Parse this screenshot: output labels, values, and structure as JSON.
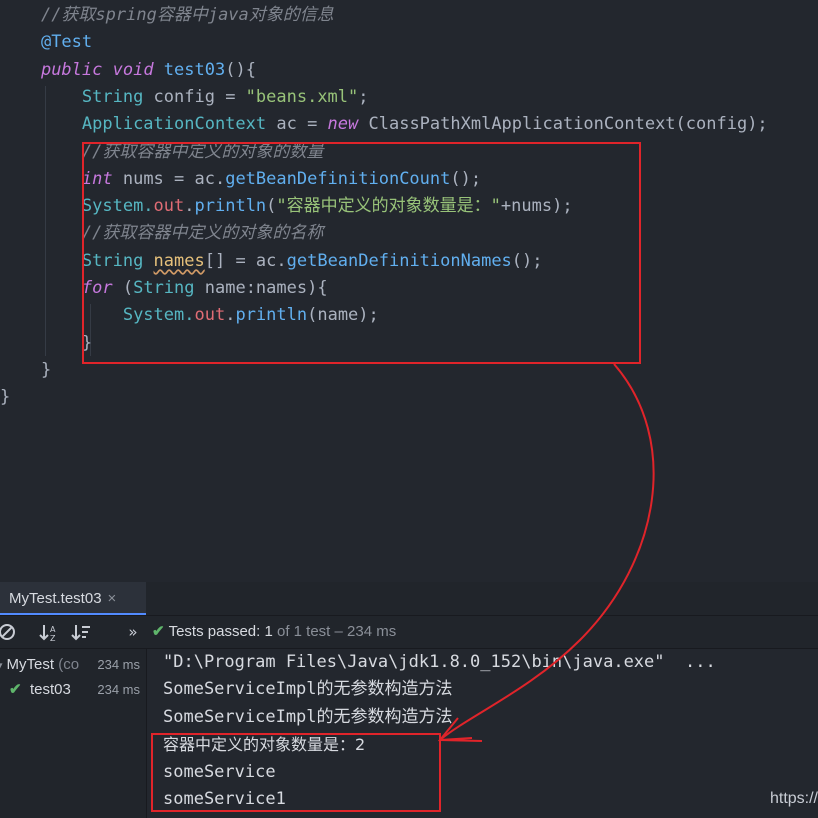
{
  "editor": {
    "lines": [
      {
        "indent": "    ",
        "parts": [
          {
            "t": "//获取spring容器中java对象的信息",
            "c": "tk-comment"
          }
        ]
      },
      {
        "indent": "    ",
        "parts": [
          {
            "t": "@Test",
            "c": "tk-anno"
          }
        ]
      },
      {
        "indent": "    ",
        "parts": [
          {
            "t": "public ",
            "c": "tk-kw"
          },
          {
            "t": "void ",
            "c": "tk-kw"
          },
          {
            "t": "test03",
            "c": "tk-fn"
          },
          {
            "t": "(){",
            "c": "tk-plain"
          }
        ]
      },
      {
        "indent": "        ",
        "parts": [
          {
            "t": "String ",
            "c": "tk-type"
          },
          {
            "t": "config = ",
            "c": "tk-plain"
          },
          {
            "t": "\"beans.xml\"",
            "c": "tk-str"
          },
          {
            "t": ";",
            "c": "tk-plain"
          }
        ]
      },
      {
        "indent": "        ",
        "parts": [
          {
            "t": "ApplicationContext ",
            "c": "tk-type"
          },
          {
            "t": "ac = ",
            "c": "tk-plain"
          },
          {
            "t": "new ",
            "c": "tk-kw"
          },
          {
            "t": "ClassPathXmlApplicationContext(config);",
            "c": "tk-plain"
          }
        ]
      },
      {
        "indent": "        ",
        "parts": [
          {
            "t": "//获取容器中定义的对象的数量",
            "c": "tk-comment"
          }
        ]
      },
      {
        "indent": "        ",
        "parts": [
          {
            "t": "int ",
            "c": "tk-kw"
          },
          {
            "t": "nums = ac.",
            "c": "tk-plain"
          },
          {
            "t": "getBeanDefinitionCount",
            "c": "tk-fn"
          },
          {
            "t": "();",
            "c": "tk-plain"
          }
        ]
      },
      {
        "indent": "        ",
        "parts": [
          {
            "t": "System.",
            "c": "tk-type"
          },
          {
            "t": "out",
            "c": "tk-field"
          },
          {
            "t": ".",
            "c": "tk-plain"
          },
          {
            "t": "println",
            "c": "tk-fn"
          },
          {
            "t": "(",
            "c": "tk-plain"
          },
          {
            "t": "\"容器中定义的对象数量是：\"",
            "c": "tk-str"
          },
          {
            "t": "+nums);",
            "c": "tk-plain"
          }
        ]
      },
      {
        "indent": "        ",
        "parts": [
          {
            "t": "//获取容器中定义的对象的名称",
            "c": "tk-comment"
          }
        ]
      },
      {
        "indent": "        ",
        "parts": [
          {
            "t": "String ",
            "c": "tk-type"
          },
          {
            "t": "names",
            "c": "tk-warn"
          },
          {
            "t": "[] = ac.",
            "c": "tk-plain"
          },
          {
            "t": "getBeanDefinitionNames",
            "c": "tk-fn"
          },
          {
            "t": "();",
            "c": "tk-plain"
          }
        ]
      },
      {
        "indent": "        ",
        "parts": [
          {
            "t": "for ",
            "c": "tk-kw"
          },
          {
            "t": "(",
            "c": "tk-plain"
          },
          {
            "t": "String ",
            "c": "tk-type"
          },
          {
            "t": "name:names){",
            "c": "tk-plain"
          }
        ]
      },
      {
        "indent": "            ",
        "parts": [
          {
            "t": "System.",
            "c": "tk-type"
          },
          {
            "t": "out",
            "c": "tk-field"
          },
          {
            "t": ".",
            "c": "tk-plain"
          },
          {
            "t": "println",
            "c": "tk-fn"
          },
          {
            "t": "(name);",
            "c": "tk-plain"
          }
        ]
      },
      {
        "indent": "        ",
        "parts": [
          {
            "t": "}",
            "c": "tk-plain"
          }
        ]
      },
      {
        "indent": "    ",
        "parts": [
          {
            "t": "}",
            "c": "tk-plain"
          }
        ]
      },
      {
        "indent": "",
        "parts": [
          {
            "t": "}",
            "c": "tk-plain"
          }
        ]
      }
    ]
  },
  "run_panel": {
    "tab_label": "MyTest.test03",
    "tab_close": "×",
    "stop_icon": "stop-icon",
    "sort_alpha_icon": "sort-alphabetically-icon",
    "sort_duration_icon": "sort-by-duration-icon",
    "more_chevron": "»",
    "status_check": "✔",
    "status_prefix": "Tests passed: ",
    "status_count": "1",
    "status_suffix": " of 1 test – 234 ms",
    "tree": [
      {
        "label": "MyTest",
        "sub": " (co",
        "time": "234 ms"
      },
      {
        "label": "test03",
        "check": "✔",
        "time": "234 ms"
      }
    ],
    "console": [
      "\"D:\\Program Files\\Java\\jdk1.8.0_152\\bin\\java.exe\"  ...",
      "SomeServiceImpl的无参数构造方法",
      "SomeServiceImpl的无参数构造方法",
      "容器中定义的对象数量是：2",
      "someService",
      "someService1"
    ]
  },
  "watermark": "https://",
  "colors": {
    "highlight_box": "#e0242a",
    "pass_green": "#5fb56b",
    "accent": "#528bff"
  }
}
